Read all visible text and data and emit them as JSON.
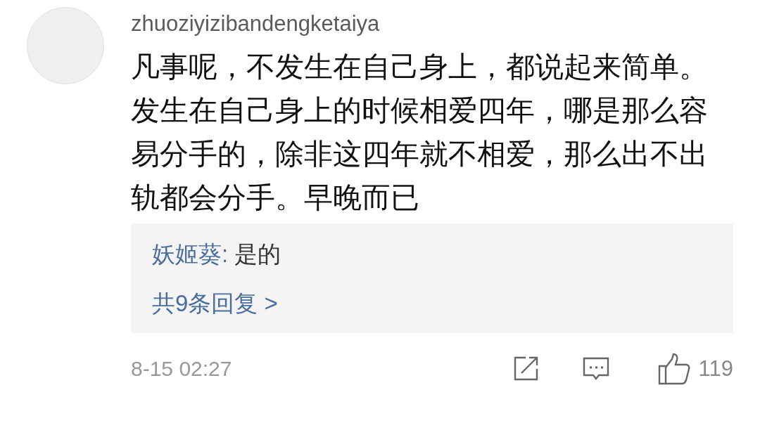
{
  "comment": {
    "username": "zhuoziyizibandengketaiya",
    "text": "凡事呢，不发生在自己身上，都说起来简单。发生在自己身上的时候相爱四年，哪是那么容易分手的，除非这四年就不相爱，那么出不出轨都会分手。早晚而已",
    "replies": [
      {
        "author": "妖姬葵:",
        "text": "是的"
      }
    ],
    "more_replies": "共9条回复 >",
    "timestamp": "8-15 02:27",
    "like_count": "119"
  }
}
